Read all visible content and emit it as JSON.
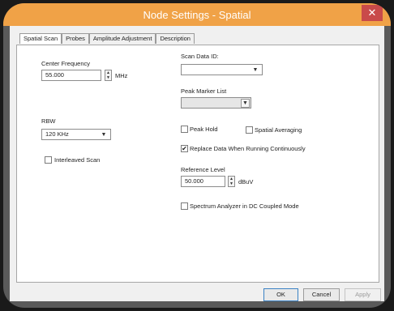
{
  "window": {
    "title": "Node Settings - Spatial",
    "close_glyph": "✕"
  },
  "tabs": [
    {
      "label": "Spatial Scan",
      "active": true
    },
    {
      "label": "Probes",
      "active": false
    },
    {
      "label": "Amplitude Adjustment",
      "active": false
    },
    {
      "label": "Description",
      "active": false
    }
  ],
  "center_frequency": {
    "label": "Center Frequency",
    "value": "55.000",
    "unit": "MHz"
  },
  "rbw": {
    "label": "RBW",
    "value": "120 KHz"
  },
  "interleaved_scan": {
    "label": "Interleaved Scan",
    "checked": false
  },
  "scan_data_id": {
    "label": "Scan Data ID:",
    "value": ""
  },
  "peak_marker_list": {
    "label": "Peak Marker List",
    "value": ""
  },
  "peak_hold": {
    "label": "Peak Hold",
    "checked": false
  },
  "spatial_averaging": {
    "label": "Spatial Averaging",
    "checked": false
  },
  "replace_data": {
    "label": "Replace Data When Running Continuously",
    "checked": true,
    "check_glyph": "✔"
  },
  "reference_level": {
    "label": "Reference Level",
    "value": "50.000",
    "unit": "dBuV"
  },
  "dc_coupled": {
    "label": "Spectrum Analyzer in DC Coupled Mode",
    "checked": false
  },
  "buttons": {
    "ok": "OK",
    "cancel": "Cancel",
    "apply": "Apply"
  }
}
